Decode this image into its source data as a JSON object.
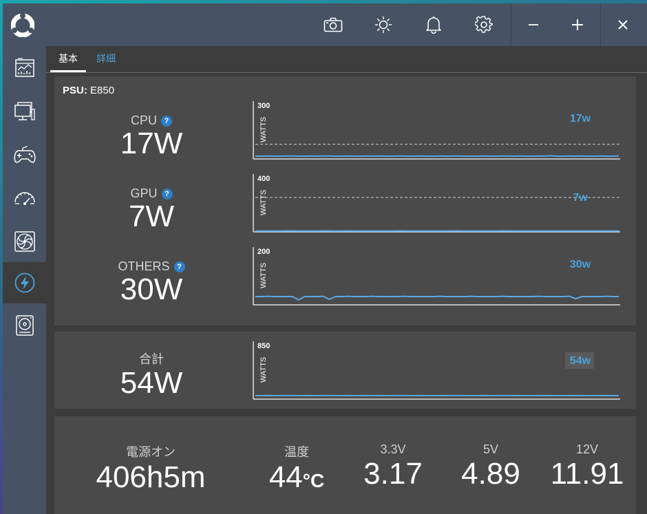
{
  "tabs": {
    "basic": "基本",
    "detail": "詳細"
  },
  "psu": {
    "label": "PSU:",
    "model": "E850"
  },
  "metrics": [
    {
      "label": "CPU",
      "help": "?",
      "value": "17W"
    },
    {
      "label": "GPU",
      "help": "?",
      "value": "7W"
    },
    {
      "label": "OTHERS",
      "help": "?",
      "value": "30W"
    }
  ],
  "total": {
    "label": "合計",
    "value": "54W"
  },
  "charts": [
    {
      "max_label": "300",
      "axis_label": "WATTS",
      "current_label": "17w",
      "ymax": 300,
      "threshold": 80,
      "values": [
        15,
        15,
        16,
        15,
        15,
        16,
        16,
        15,
        15,
        16,
        15,
        16,
        16,
        15,
        15,
        16,
        15,
        15,
        16,
        15,
        16,
        15,
        15,
        16,
        16,
        15,
        15,
        16,
        15,
        15,
        16,
        15,
        16,
        16,
        15,
        15,
        15,
        16,
        15,
        15,
        16,
        16,
        15,
        16,
        15,
        15,
        16,
        15,
        18,
        15,
        15,
        16,
        15,
        16,
        15,
        15,
        16,
        15,
        15,
        17
      ]
    },
    {
      "max_label": "400",
      "axis_label": "WATTS",
      "current_label": "7w",
      "ymax": 400,
      "threshold": 250,
      "values": [
        6,
        6,
        7,
        6,
        6,
        7,
        7,
        6,
        6,
        7,
        6,
        7,
        7,
        6,
        6,
        7,
        6,
        6,
        7,
        6,
        7,
        6,
        6,
        7,
        7,
        6,
        6,
        7,
        6,
        6,
        7,
        6,
        7,
        7,
        6,
        6,
        6,
        7,
        6,
        6,
        7,
        7,
        6,
        7,
        6,
        6,
        7,
        6,
        7,
        6,
        6,
        7,
        6,
        7,
        6,
        6,
        7,
        6,
        6,
        7
      ]
    },
    {
      "max_label": "200",
      "axis_label": "WATTS",
      "current_label": "30w",
      "ymax": 200,
      "threshold": null,
      "values": [
        30,
        30,
        31,
        30,
        30,
        30,
        30,
        18,
        30,
        30,
        30,
        31,
        20,
        30,
        30,
        31,
        30,
        30,
        30,
        31,
        30,
        30,
        30,
        30,
        31,
        30,
        30,
        30,
        30,
        30,
        31,
        30,
        30,
        30,
        30,
        31,
        30,
        30,
        30,
        30,
        31,
        30,
        30,
        30,
        30,
        30,
        31,
        30,
        30,
        30,
        30,
        31,
        22,
        30,
        30,
        30,
        30,
        31,
        30,
        30
      ]
    },
    {
      "max_label": "850",
      "axis_label": "WATTS",
      "current_label": "54w",
      "ymax": 850,
      "threshold": null,
      "values": [
        53,
        53,
        54,
        53,
        53,
        54,
        54,
        53,
        53,
        54,
        53,
        54,
        54,
        53,
        53,
        54,
        53,
        53,
        54,
        53,
        54,
        53,
        53,
        54,
        54,
        53,
        53,
        54,
        53,
        53,
        54,
        53,
        54,
        54,
        53,
        53,
        53,
        54,
        53,
        53,
        54,
        54,
        53,
        54,
        53,
        53,
        54,
        53,
        54,
        53,
        53,
        54,
        53,
        54,
        53,
        53,
        54,
        53,
        53,
        54
      ]
    }
  ],
  "stats": [
    {
      "label": "電源オン",
      "value": "406h5m",
      "unit": ""
    },
    {
      "label": "温度",
      "value": "44",
      "unit": "°C"
    },
    {
      "label": "3.3V",
      "value": "3.17",
      "unit": ""
    },
    {
      "label": "5V",
      "value": "4.89",
      "unit": ""
    },
    {
      "label": "12V",
      "value": "11.91",
      "unit": ""
    }
  ],
  "colors": {
    "accent": "#4aa3df",
    "line": "#5aa8e6",
    "titlebar": "#475264",
    "panel": "#4a4a4a"
  }
}
